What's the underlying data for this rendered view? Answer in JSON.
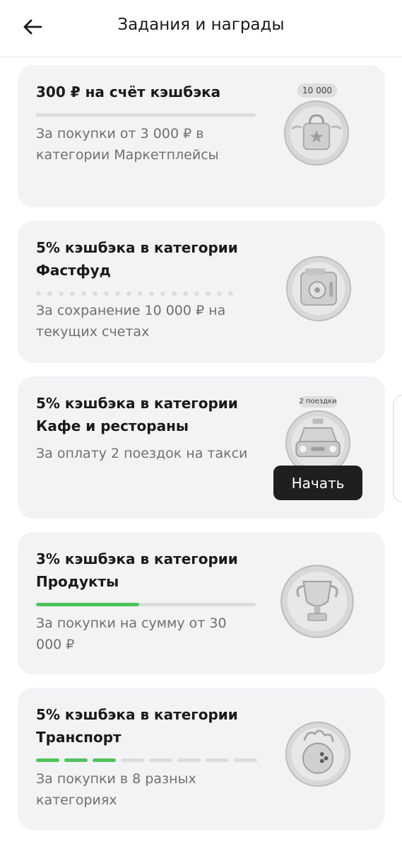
{
  "header": {
    "title": "Задания и награды"
  },
  "tasks": [
    {
      "title": "300 ₽ на счёт кэшбэка",
      "description": "За покупки от 3 000 ₽ в категории Маркетплейсы",
      "badge_label": "10 000",
      "badge_icon": "shopping-bag-star-icon",
      "progress": 0
    },
    {
      "title": "5% кэшбэка в категории Фастфуд",
      "description": "За сохранение 10 000 ₽ на текущих счетах",
      "badge_icon": "safe-icon",
      "progress": 0
    },
    {
      "title": "5% кэшбэка в категории Кафе и рестораны",
      "description": "За оплату 2 поездок на такси",
      "badge_label": "2 поездки",
      "badge_icon": "taxi-car-icon",
      "action_label": "Начать"
    },
    {
      "title": "3% кэшбэка в категории Продукты",
      "description": "За покупки на сумму от 30 000 ₽",
      "badge_icon": "trophy-icon",
      "progress": 0.47
    },
    {
      "title": "5% кэшбэка в категории Транспорт",
      "description": "За покупки в 8 разных категориях",
      "badge_icon": "bowling-ball-icon",
      "progress_steps_total": 8,
      "progress_steps_done": 3
    }
  ],
  "colors": {
    "progress": "#4ec35a",
    "card_bg": "#f2f3f5",
    "button_bg": "#1f1f1f"
  }
}
